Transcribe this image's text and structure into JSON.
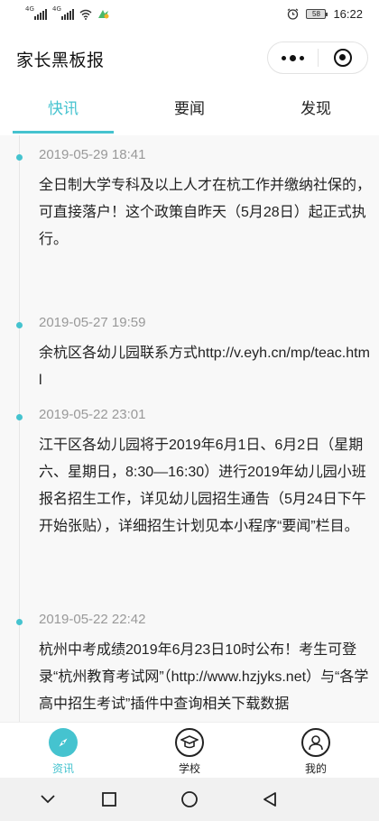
{
  "status_bar": {
    "network_tag_1": "4G",
    "network_tag_2": "4G",
    "battery": "58",
    "time": "16:22"
  },
  "header": {
    "title": "家长黑板报"
  },
  "tabs": [
    {
      "label": "快讯",
      "active": true
    },
    {
      "label": "要闻",
      "active": false
    },
    {
      "label": "发现",
      "active": false
    }
  ],
  "feed": [
    {
      "time": "2019-05-29 18:41",
      "text": "全日制大学专科及以上人才在杭工作并缴纳社保的，可直接落户！这个政策自昨天（5月28日）起正式执行。"
    },
    {
      "time": "2019-05-27 19:59",
      "text": "余杭区各幼儿园联系方式http://v.eyh.cn/mp/teac.html"
    },
    {
      "time": "2019-05-22 23:01",
      "text": "江干区各幼儿园将于2019年6月1日、6月2日（星期六、星期日，8:30—16:30）进行2019年幼儿园小班报名招生工作，详见幼儿园招生通告（5月24日下午开始张贴），详细招生计划见本小程序“要闻”栏目。"
    },
    {
      "time": "2019-05-22 22:42",
      "text": "杭州中考成绩2019年6月23日10时公布！考生可登录“杭州教育考试网”（http://www.hzjyks.net）与“各学高中招生考试”插件中查询相关下载数据"
    }
  ],
  "tabbar": [
    {
      "label": "资讯",
      "icon": "compass-icon",
      "active": true
    },
    {
      "label": "学校",
      "icon": "graduation-cap-icon",
      "active": false
    },
    {
      "label": "我的",
      "icon": "user-icon",
      "active": false
    }
  ],
  "colors": {
    "accent": "#45c3cf",
    "feed_background": "#f8f8f8",
    "time_text": "#999999"
  }
}
